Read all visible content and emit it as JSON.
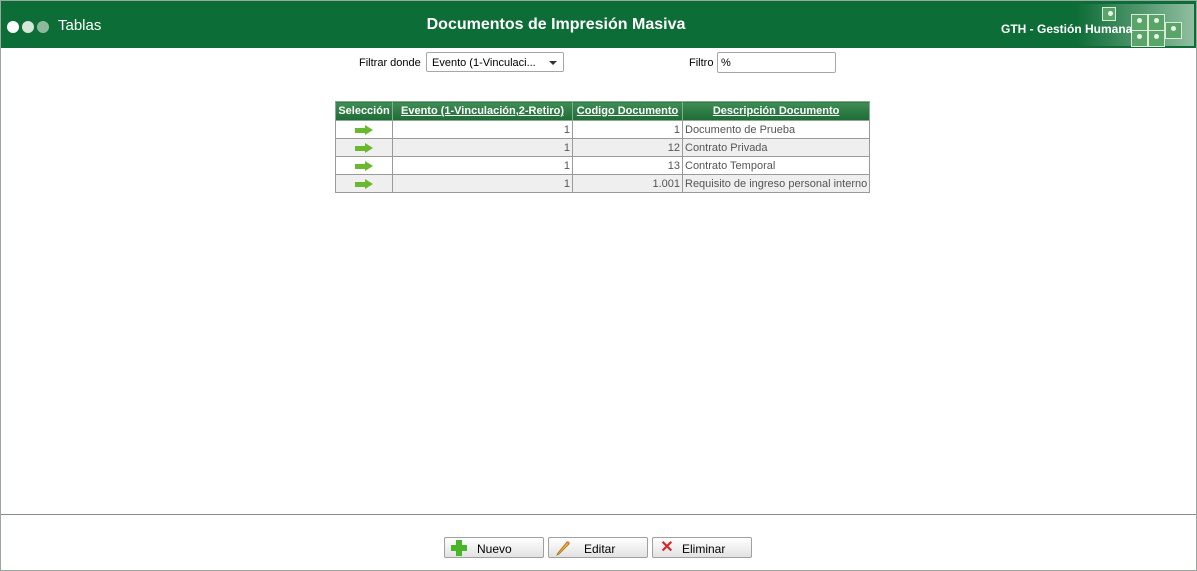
{
  "header": {
    "breadcrumb": "Tablas",
    "title": "Documentos de Impresión Masiva",
    "app_name": "GTH - Gestión Humana"
  },
  "filter": {
    "field_label": "Filtrar donde",
    "field_selected": "Evento (1-Vinculaci...",
    "value_label": "Filtro",
    "value": "%"
  },
  "table": {
    "headers": [
      "Selección",
      "Evento (1-Vinculación,2-Retiro)",
      "Codigo Documento",
      "Descripción Documento"
    ],
    "rows": [
      {
        "evento": "1",
        "codigo": "1",
        "descripcion": "Documento de Prueba"
      },
      {
        "evento": "1",
        "codigo": "12",
        "descripcion": "Contrato Privada"
      },
      {
        "evento": "1",
        "codigo": "13",
        "descripcion": "Contrato Temporal"
      },
      {
        "evento": "1",
        "codigo": "1.001",
        "descripcion": "Requisito de ingreso personal interno"
      }
    ]
  },
  "actions": {
    "new_label": "Nuevo",
    "edit_label": "Editar",
    "delete_label": "Eliminar"
  },
  "colors": {
    "header_bg": "#0d6d36",
    "arrow": "#69b82f"
  }
}
